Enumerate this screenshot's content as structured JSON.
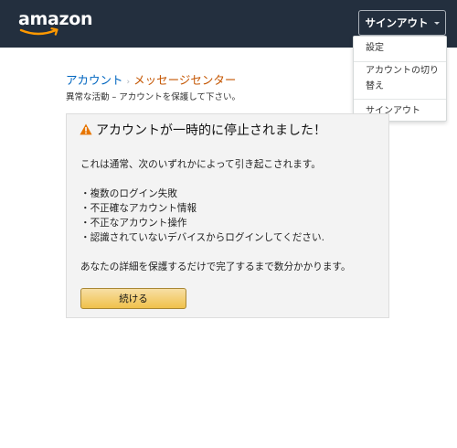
{
  "header": {
    "logo_text": "amazon",
    "signout_label": "サインアウト",
    "background": "#232f3e"
  },
  "dropdown": {
    "items": [
      {
        "label": "設定"
      },
      {
        "label": "アカウントの切り替え"
      },
      {
        "label": "サインアウト"
      }
    ]
  },
  "breadcrumb": {
    "parent": "アカウント",
    "separator": "›",
    "current": "メッセージセンター"
  },
  "subtitle": "異常な活動 – アカウントを保護して下さい。",
  "alert": {
    "icon": "warning-icon",
    "icon_color": "#e77600",
    "title": "アカウントが一時的に停止されました！",
    "intro": "これは通常、次のいずれかによって引き起こされます。",
    "reasons": [
      "・複数のログイン失敗",
      "・不正確なアカウント情報",
      "・不正なアカウント操作",
      "・認識されていないデバイスからログインしてください."
    ],
    "outro": "あなたの詳細を保護するだけで完了するまで数分かかります。",
    "continue_label": "続ける"
  },
  "colors": {
    "link": "#0066c0",
    "current_breadcrumb": "#c45500",
    "button_gold": "#f0c14b"
  }
}
